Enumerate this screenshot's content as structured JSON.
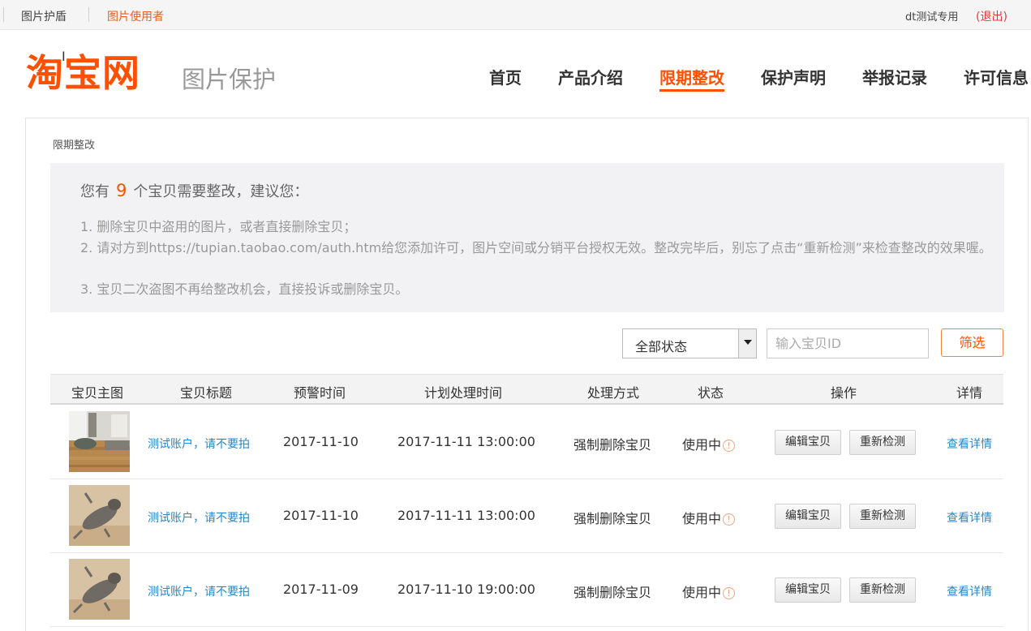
{
  "topbar": {
    "link_protect": "图片护盾",
    "link_user": "图片使用者",
    "username": "dt测试专用",
    "logout": "(退出)"
  },
  "header": {
    "logo": "淘宝网",
    "subtitle": "图片保护",
    "nav": [
      {
        "label": "首页",
        "active": false
      },
      {
        "label": "产品介绍",
        "active": false
      },
      {
        "label": "限期整改",
        "active": true
      },
      {
        "label": "保护声明",
        "active": false
      },
      {
        "label": "举报记录",
        "active": false
      },
      {
        "label": "许可信息",
        "active": false
      }
    ]
  },
  "breadcrumb": "限期整改",
  "notice": {
    "prefix": "您有",
    "count": "9",
    "suffix": "个宝贝需要整改，建议您：",
    "tips": [
      "1. 删除宝贝中盗用的图片，或者直接删除宝贝；",
      "2. 请对方到https://tupian.taobao.com/auth.htm给您添加许可，图片空间或分销平台授权无效。整改完毕后，别忘了点击“重新检测”来检查整改的效果喔。",
      "3. 宝贝二次盗图不再给整改机会，直接投诉或删除宝贝。"
    ]
  },
  "filter": {
    "status_selected": "全部状态",
    "id_placeholder": "输入宝贝ID",
    "button": "筛选"
  },
  "table": {
    "headers": [
      "宝贝主图",
      "宝贝标题",
      "预警时间",
      "计划处理时间",
      "处理方式",
      "状态",
      "操作",
      "详情"
    ],
    "rows": [
      {
        "image": "room-floor-photo",
        "title": "测试账户，请不要拍",
        "warn_time": "2017-11-10",
        "plan_time": "2017-11-11 13:00:00",
        "method": "强制删除宝贝",
        "status": "使用中",
        "edit": "编辑宝贝",
        "recheck": "重新检测",
        "detail": "查看详情"
      },
      {
        "image": "cat-photo",
        "title": "测试账户，请不要拍",
        "warn_time": "2017-11-10",
        "plan_time": "2017-11-11 13:00:00",
        "method": "强制删除宝贝",
        "status": "使用中",
        "edit": "编辑宝贝",
        "recheck": "重新检测",
        "detail": "查看详情"
      },
      {
        "image": "cat-photo",
        "title": "测试账户，请不要拍",
        "warn_time": "2017-11-09",
        "plan_time": "2017-11-10 19:00:00",
        "method": "强制删除宝贝",
        "status": "使用中",
        "edit": "编辑宝贝",
        "recheck": "重新检测",
        "detail": "查看详情"
      }
    ]
  },
  "colors": {
    "brand": "#ff5000",
    "link": "#2a87c4",
    "warning": "#f2a37a"
  }
}
